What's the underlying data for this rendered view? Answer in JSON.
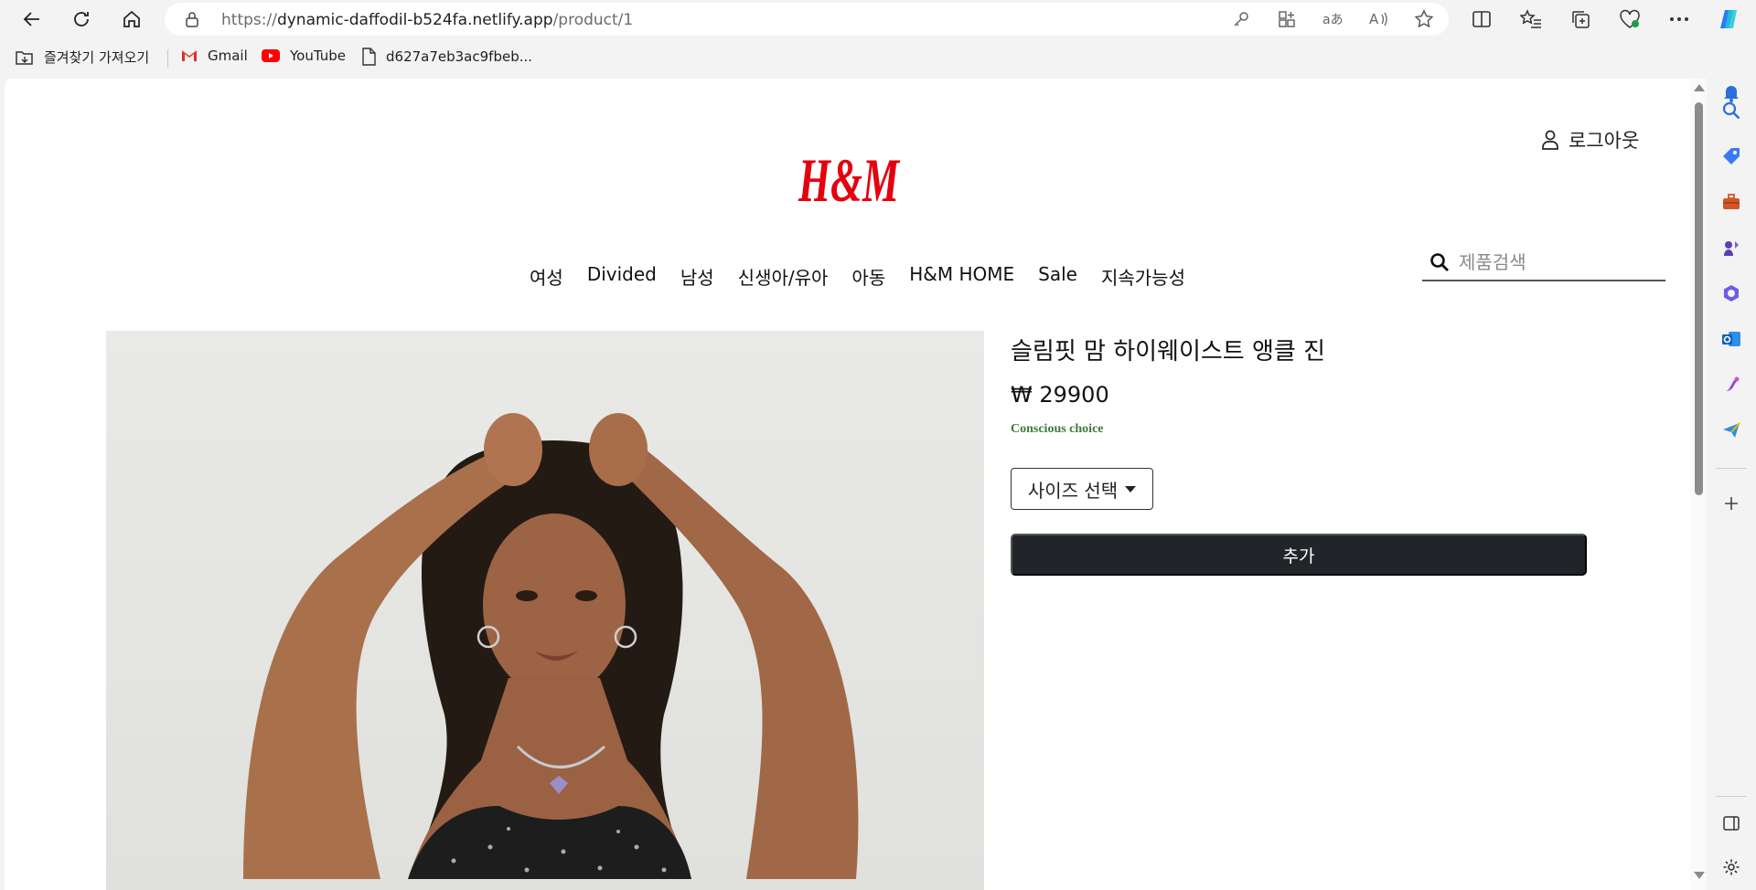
{
  "browser": {
    "url_scheme": "https://",
    "url_host": "dynamic-daffodil-b524fa.netlify.app",
    "url_path": "/product/1"
  },
  "bookmarks": {
    "import_label": "즐겨찾기 가져오기",
    "items": [
      {
        "label": "Gmail",
        "icon": "gmail-icon"
      },
      {
        "label": "YouTube",
        "icon": "youtube-icon"
      },
      {
        "label": "d627a7eb3ac9fbeb...",
        "icon": "file-icon"
      }
    ]
  },
  "header": {
    "login_label": "로그아웃",
    "logo_text": "H&M",
    "logo_color": "#e50010",
    "menu": [
      "여성",
      "Divided",
      "남성",
      "신생아/유아",
      "아동",
      "H&M HOME",
      "Sale",
      "지속가능성"
    ],
    "search_placeholder": "제품검색"
  },
  "product": {
    "title": "슬림핏 맘 하이웨이스트 앵클 진",
    "price": "₩ 29900",
    "badge": "Conscious choice",
    "badge_color": "#3f7a3a",
    "size_label": "사이즈 선택",
    "add_label": "추가",
    "add_color": "#212529"
  }
}
